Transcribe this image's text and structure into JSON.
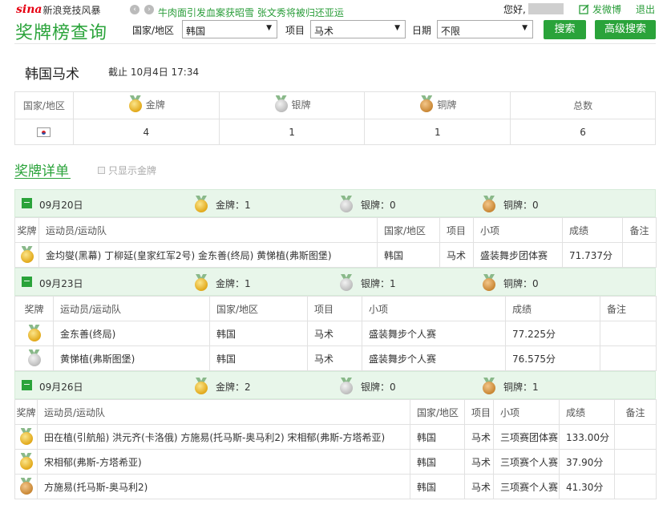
{
  "topbar": {
    "logo_brand": "sina",
    "logo_text": "新浪竞技风暴",
    "news_text": "牛肉面引发血案获昭雪 张文秀将被归还亚运",
    "greeting": "您好,",
    "weibo_label": "发微博",
    "logout_label": "退出"
  },
  "header": {
    "title": "奖牌榜查询",
    "country_label": "国家/地区",
    "country_value": "韩国",
    "event_label": "项目",
    "event_value": "马术",
    "date_label": "日期",
    "date_value": "不限",
    "search_label": "搜索",
    "advanced_label": "高级搜索"
  },
  "summary": {
    "title": "韩国马术",
    "asof": "截止 10月4日 17:34",
    "headers": {
      "country": "国家/地区",
      "gold": "金牌",
      "silver": "银牌",
      "bronze": "铜牌",
      "total": "总数"
    },
    "gold": "4",
    "silver": "1",
    "bronze": "1",
    "total": "6"
  },
  "details": {
    "title": "奖牌详单",
    "gold_only_label": "只显示金牌",
    "col_headers": {
      "medal": "奖牌",
      "athlete": "运动员/运动队",
      "country": "国家/地区",
      "event": "项目",
      "sub": "小项",
      "score": "成绩",
      "note": "备注"
    },
    "days": [
      {
        "date": "09月20日",
        "gold": "金牌：1",
        "silver": "银牌：0",
        "bronze": "铜牌：0",
        "rows": [
          {
            "medal": "gold",
            "athlete": "金均燮(黑幕) 丁柳延(皇家红军2号) 金东善(终局) 黄悌植(弗斯图堡)",
            "country": "韩国",
            "event": "马术",
            "sub": "盛装舞步团体赛",
            "score": "71.737分",
            "note": ""
          }
        ]
      },
      {
        "date": "09月23日",
        "gold": "金牌：1",
        "silver": "银牌：1",
        "bronze": "铜牌：0",
        "rows": [
          {
            "medal": "gold",
            "athlete": "金东善(终局)",
            "country": "韩国",
            "event": "马术",
            "sub": "盛装舞步个人赛",
            "score": "77.225分",
            "note": ""
          },
          {
            "medal": "silver",
            "athlete": "黄悌植(弗斯图堡)",
            "country": "韩国",
            "event": "马术",
            "sub": "盛装舞步个人赛",
            "score": "76.575分",
            "note": ""
          }
        ]
      },
      {
        "date": "09月26日",
        "gold": "金牌：2",
        "silver": "银牌：0",
        "bronze": "铜牌：1",
        "rows": [
          {
            "medal": "gold",
            "athlete": "田在植(引航船) 洪元齐(卡洛俄) 方施易(托马斯-奥马利2) 宋相郁(弗斯-方塔希亚)",
            "country": "韩国",
            "event": "马术",
            "sub": "三项赛团体赛",
            "score": "133.00分",
            "note": ""
          },
          {
            "medal": "gold",
            "athlete": "宋相郁(弗斯-方塔希亚)",
            "country": "韩国",
            "event": "马术",
            "sub": "三项赛个人赛",
            "score": "37.90分",
            "note": ""
          },
          {
            "medal": "bronze",
            "athlete": "方施易(托马斯-奥马利2)",
            "country": "韩国",
            "event": "马术",
            "sub": "三项赛个人赛",
            "score": "41.30分",
            "note": ""
          }
        ]
      }
    ]
  }
}
